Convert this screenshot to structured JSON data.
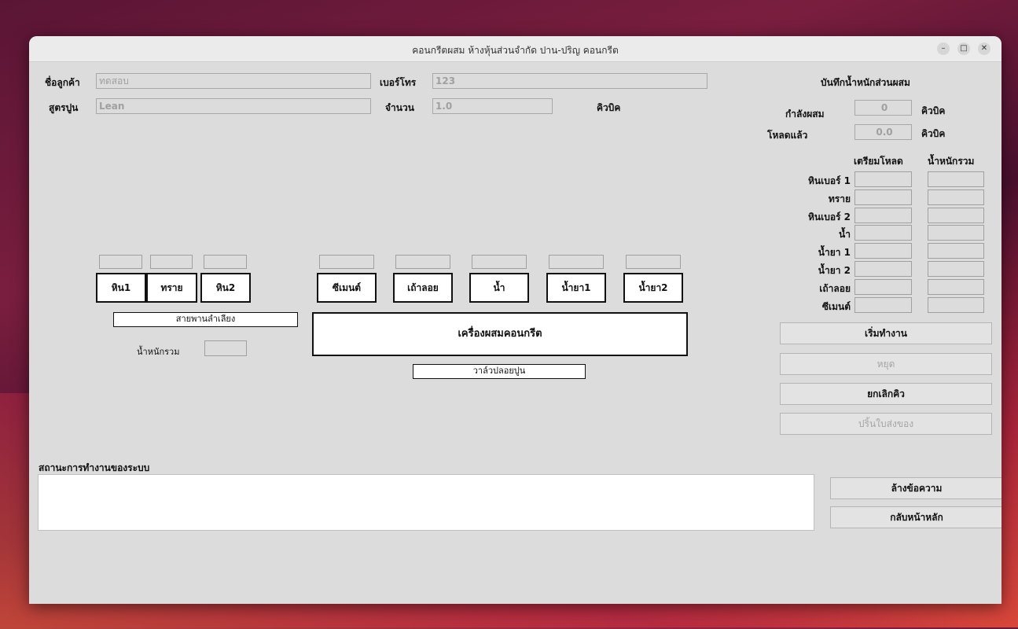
{
  "window": {
    "title": "คอนกรีตผสม ห้างหุ้นส่วนจำกัด ปาน-ปริญ คอนกรีต",
    "controls": {
      "minimize": "–",
      "maximize": "□",
      "close": "✕"
    }
  },
  "form": {
    "customer_label": "ชื่อลูกค้า",
    "customer_value": "ทดสอบ",
    "phone_label": "เบอร์โทร",
    "phone_value": "123",
    "recipe_label": "สูตรปูน",
    "recipe_value": "Lean",
    "amount_label": "จำนวน",
    "amount_value": "1.0",
    "amount_unit": "คิวบิค"
  },
  "diagram": {
    "aggregates": [
      "หิน1",
      "ทราย",
      "หิน2"
    ],
    "mixers": [
      "ซีเมนต์",
      "เถ้าลอย",
      "น้ำ",
      "น้ำยา1",
      "น้ำยา2"
    ],
    "conveyor": "สายพานลำเลียง",
    "total_weight_label": "น้ำหนักรวม",
    "mixer_label": "เครื่องผสมคอนกรีต",
    "valve_label": "วาล์วปลอยปูน"
  },
  "record": {
    "title": "บันทึกน้ำหนักส่วนผสม",
    "mixing_label": "กำลังผสม",
    "mixing_value": "0",
    "loaded_label": "โหลดแล้ว",
    "loaded_value": "0.0",
    "unit": "คิวบิค",
    "col_prepare": "เตรียมโหลด",
    "col_total": "น้ำหนักรวม",
    "rows": [
      "หินเบอร์ 1",
      "ทราย",
      "หินเบอร์ 2",
      "น้ำ",
      "น้ำยา 1",
      "น้ำยา 2",
      "เถ้าลอย",
      "ซีเมนต์"
    ]
  },
  "buttons": {
    "start": "เริ่มทำงาน",
    "stop": "หยุด",
    "cancel": "ยกเลิกคิว",
    "print": "ปริ้นใบส่งของ",
    "clear": "ล้างข้อความ",
    "home": "กลับหน้าหลัก"
  },
  "status": {
    "label": "สถานะการทำงานของระบบ",
    "text": ""
  }
}
